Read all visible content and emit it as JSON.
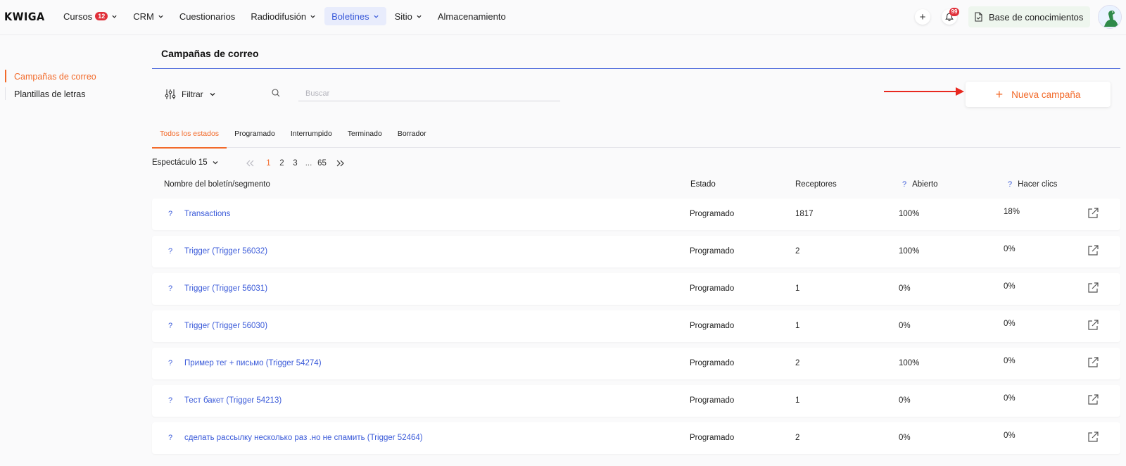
{
  "app": {
    "logo": "KWIGA"
  },
  "nav": {
    "items": [
      {
        "label": "Cursos",
        "badge": "12",
        "dropdown": true,
        "active": false
      },
      {
        "label": "CRM",
        "dropdown": true,
        "active": false
      },
      {
        "label": "Cuestionarios",
        "dropdown": false,
        "active": false
      },
      {
        "label": "Radiodifusión",
        "dropdown": true,
        "active": false
      },
      {
        "label": "Boletines",
        "dropdown": true,
        "active": true
      },
      {
        "label": "Sitio",
        "dropdown": true,
        "active": false
      },
      {
        "label": "Almacenamiento",
        "dropdown": false,
        "active": false
      }
    ]
  },
  "topbar": {
    "plus_icon": "+",
    "notifications_count": "99",
    "knowledge_base_label": "Base de conocimientos"
  },
  "sidebar": {
    "items": [
      {
        "label": "Campañas de correo",
        "active": true
      },
      {
        "label": "Plantillas de letras",
        "active": false
      }
    ]
  },
  "page": {
    "title": "Campañas de correo",
    "filter_label": "Filtrar",
    "search_placeholder": "Buscar",
    "new_campaign_label": "Nueva campaña",
    "accent_color": "#f26a2a",
    "link_color": "#3a5ad9"
  },
  "tabs": [
    "Todos los estados",
    "Programado",
    "Interrumpido",
    "Terminado",
    "Borrador"
  ],
  "pagination": {
    "per_page_label": "Espectáculo 15",
    "pages": [
      "1",
      "2",
      "3",
      "...",
      "65"
    ],
    "current": "1"
  },
  "table": {
    "headers": {
      "name": "Nombre del boletín/segmento",
      "status": "Estado",
      "recipients": "Receptores",
      "opened": "Abierto",
      "clicks": "Hacer clics",
      "help_mark": "?"
    },
    "rows": [
      {
        "name": "Transactions",
        "status": "Programado",
        "recipients": "1817",
        "opened": "100%",
        "clicks": "18%"
      },
      {
        "name": "Trigger (Trigger 56032)",
        "status": "Programado",
        "recipients": "2",
        "opened": "100%",
        "clicks": "0%"
      },
      {
        "name": "Trigger (Trigger 56031)",
        "status": "Programado",
        "recipients": "1",
        "opened": "0%",
        "clicks": "0%"
      },
      {
        "name": "Trigger (Trigger 56030)",
        "status": "Programado",
        "recipients": "1",
        "opened": "0%",
        "clicks": "0%"
      },
      {
        "name": "Пример тег + письмо (Trigger 54274)",
        "status": "Programado",
        "recipients": "2",
        "opened": "100%",
        "clicks": "0%"
      },
      {
        "name": "Тест бакет (Trigger 54213)",
        "status": "Programado",
        "recipients": "1",
        "opened": "0%",
        "clicks": "0%"
      },
      {
        "name": "сделать рассылку несколько раз .но не спамить (Trigger 52464)",
        "status": "Programado",
        "recipients": "2",
        "opened": "0%",
        "clicks": "0%"
      }
    ]
  }
}
